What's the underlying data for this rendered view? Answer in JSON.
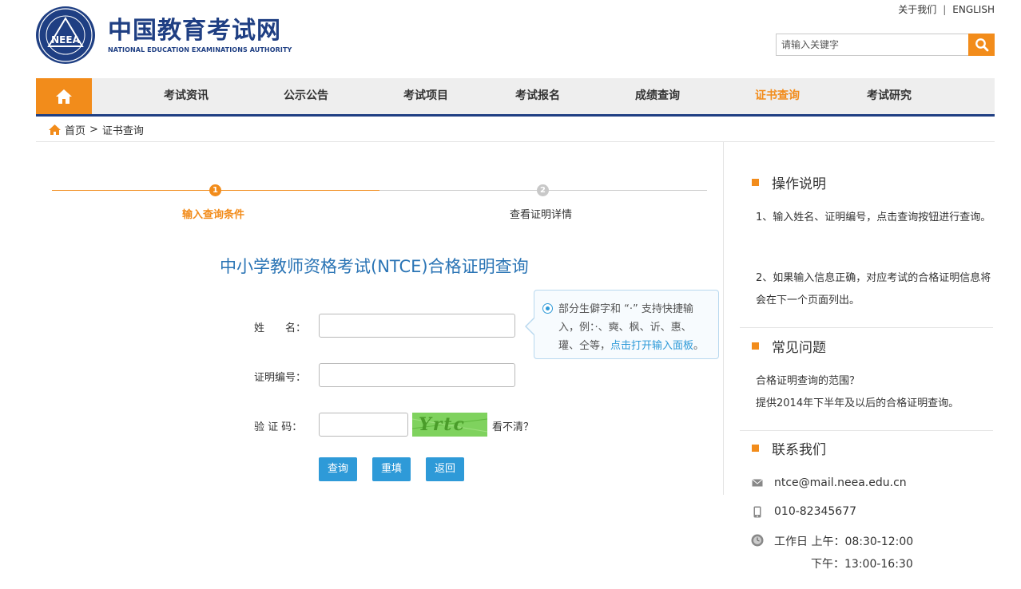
{
  "header": {
    "logo_cn": "中国教育考试网",
    "logo_en": "NATIONAL EDUCATION EXAMINATIONS AUTHORITY",
    "logo_badge": "NEEA",
    "about_link": "关于我们",
    "link_sep": "|",
    "english_link": "ENGLISH",
    "search_placeholder": "请输入关键字"
  },
  "nav": {
    "items": [
      {
        "label": "考试资讯"
      },
      {
        "label": "公示公告"
      },
      {
        "label": "考试项目"
      },
      {
        "label": "考试报名"
      },
      {
        "label": "成绩查询"
      },
      {
        "label": "证书查询"
      },
      {
        "label": "考试研究"
      }
    ],
    "active": "证书查询"
  },
  "breadcrumb": {
    "home": "首页",
    "sep": ">",
    "current": "证书查询"
  },
  "steps": [
    {
      "num": "1",
      "label": "输入查询条件"
    },
    {
      "num": "2",
      "label": "查看证明详情"
    }
  ],
  "form": {
    "title": "中小学教师资格考试(NTCE)合格证明查询",
    "name_label": "姓　　名：",
    "cert_label": "证明编号：",
    "captcha_label": "验 证 码：",
    "name_value": "",
    "cert_value": "",
    "captcha_value": "",
    "captcha_image_text": "Yrtc",
    "refresh_label": "看不清？",
    "buttons": {
      "query": "查询",
      "reset": "重填",
      "back": "返回"
    }
  },
  "tooltip": {
    "text_line1": "部分生僻字和 “·” 支持快捷输",
    "text_line2": "入，例：·、奭、枫、䜣、惠、",
    "text_line3": "瓘、仝等，",
    "link": "点击打开输入面板",
    "tail": "。"
  },
  "sidebar": {
    "ops_title": "操作说明",
    "ops_1": "1、输入姓名、证明编号，点击查询按钮进行查询。",
    "ops_2": "2、如果输入信息正确，对应考试的合格证明信息将会在下一个页面列出。",
    "faq_title": "常见问题",
    "faq_q": "合格证明查询的范围？",
    "faq_a": "提供2014年下半年及以后的合格证明查询。",
    "contact_title": "联系我们",
    "email": "ntce@mail.neea.edu.cn",
    "phone": "010-82345677",
    "hours_am": "工作日 上午：08:30-12:00",
    "hours_pm": "下午：13:00-16:30"
  },
  "colors": {
    "brand_blue": "#1f3f83",
    "accent_orange": "#f28c1b",
    "button_blue": "#2e9ad8",
    "title_blue": "#2a74b5"
  },
  "icons": {
    "search": "search-icon",
    "home": "home-icon",
    "mail": "mail-icon",
    "phone": "phone-icon",
    "clock": "clock-icon"
  }
}
